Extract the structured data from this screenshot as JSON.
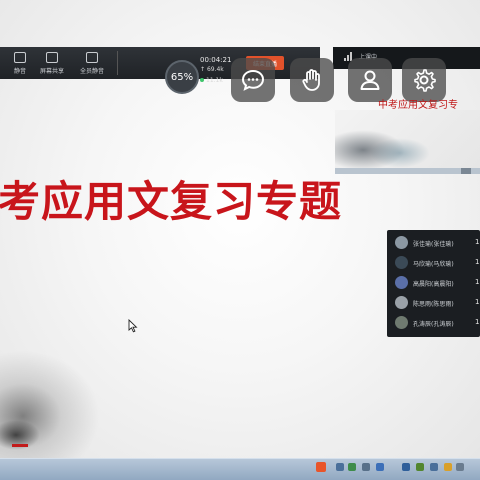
{
  "toolbar": {
    "items": [
      {
        "label": "静音",
        "icon": "mute-icon"
      },
      {
        "label": "屏幕共享",
        "icon": "screen-share-icon"
      },
      {
        "label": "全员静音",
        "icon": "mute-all-icon"
      }
    ],
    "cpu_value": "65%",
    "timer": "00:04:21",
    "upload_stat": "69.4k",
    "download_stat": "11.1k",
    "end_label": "结束直播"
  },
  "live": {
    "status_label": "上课中"
  },
  "floating_buttons": [
    {
      "name": "chat-button",
      "icon": "chat-bubble-icon"
    },
    {
      "name": "raise-hand-button",
      "icon": "hand-icon"
    },
    {
      "name": "profile-button",
      "icon": "user-icon"
    },
    {
      "name": "settings-button",
      "icon": "gear-icon"
    }
  ],
  "slide": {
    "title": "考应用文复习专题",
    "header_text": "中考应用文复习专"
  },
  "participants": [
    {
      "name": "张佳瑜(张佳瑜)",
      "count": "1",
      "avatar_color": "#8c98a3"
    },
    {
      "name": "马欣瑜(马欣瑜)",
      "count": "1",
      "avatar_color": "#3b4a57"
    },
    {
      "name": "高晨阳(高晨阳)",
      "count": "1",
      "avatar_color": "#5a6fa8"
    },
    {
      "name": "陈思雨(陈思雨)",
      "count": "1",
      "avatar_color": "#9aa1a8"
    },
    {
      "name": "孔涛辰(孔涛辰)",
      "count": "1",
      "avatar_color": "#6f7a70"
    }
  ],
  "colors": {
    "title_red": "#c8151b",
    "end_button": "#e2522b",
    "participant_panel": "#1b1e22"
  }
}
